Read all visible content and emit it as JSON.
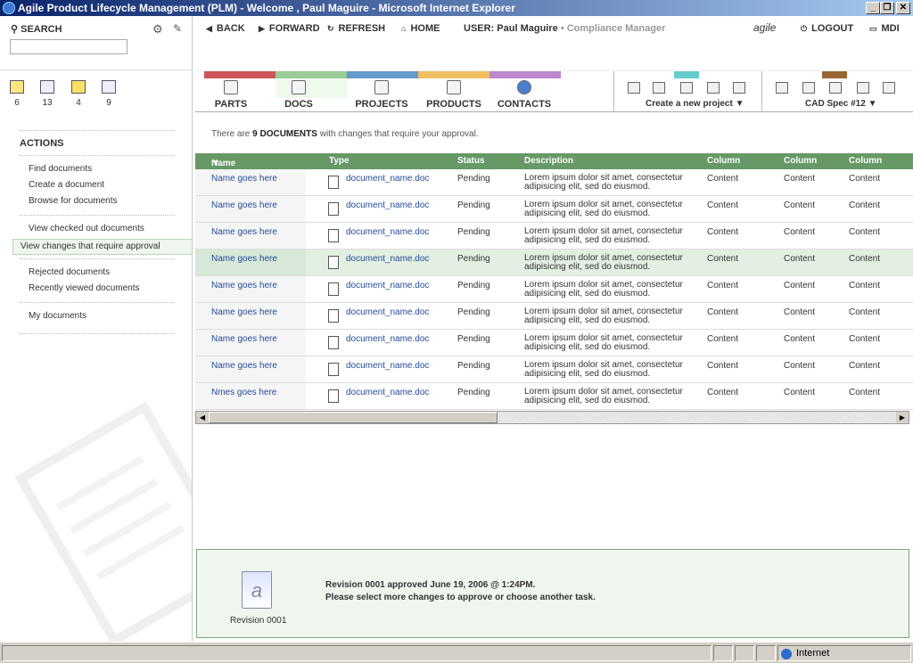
{
  "window": {
    "title": "Agile Product Lifecycle Management (PLM) - Welcome , Paul Maguire - Microsoft Internet Explorer"
  },
  "left": {
    "search_label": "SEARCH",
    "quick_counts": [
      "6",
      "13",
      "4",
      "9"
    ],
    "actions_title": "ACTIONS",
    "group1": [
      "Find documents",
      "Create a document",
      "Browse for documents"
    ],
    "group2": [
      "View checked out documents",
      "View changes that require approval"
    ],
    "group3": [
      "Rejected documents",
      "Recently viewed documents"
    ],
    "group4": [
      "My documents"
    ]
  },
  "toolbar": {
    "back": "BACK",
    "forward": "FORWARD",
    "refresh": "REFRESH",
    "home": "HOME",
    "user_label": "USER:",
    "user_name": "Paul Maguire",
    "user_role": "• Compliance Manager",
    "brand": "agile",
    "logout": "LOGOUT",
    "mdi": "MDI"
  },
  "nav": {
    "tabs": [
      "PARTS",
      "DOCS",
      "PROJECTS",
      "PRODUCTS",
      "CONTACTS"
    ],
    "tab_colors": [
      "#cc5555",
      "#99cc99",
      "#6699cc",
      "#f0c060",
      "#bb88cc"
    ],
    "project_dropdown": "Create a new project",
    "cad_dropdown": "CAD Spec #12"
  },
  "info": {
    "prefix": "There are ",
    "count": "9 DOCUMENTS",
    "suffix": " with changes that require your approval."
  },
  "table": {
    "headers": [
      "Name",
      "Type",
      "Status",
      "Description",
      "Column",
      "Column",
      "Column"
    ],
    "sort_indicator": "▼",
    "rows": [
      {
        "name": "Name goes here",
        "type": "document_name.doc",
        "status": "Pending",
        "desc": "Lorem ipsum dolor sit amet, consectetur adipisicing elit, sed do eiusmod.",
        "c1": "Content",
        "c2": "Content",
        "c3": "Content"
      },
      {
        "name": "Name goes here",
        "type": "document_name.doc",
        "status": "Pending",
        "desc": "Lorem ipsum dolor sit amet, consectetur adipisicing elit, sed do eiusmod.",
        "c1": "Content",
        "c2": "Content",
        "c3": "Content"
      },
      {
        "name": "Name goes here",
        "type": "document_name.doc",
        "status": "Pending",
        "desc": "Lorem ipsum dolor sit amet, consectetur adipisicing elit, sed do eiusmod.",
        "c1": "Content",
        "c2": "Content",
        "c3": "Content"
      },
      {
        "name": "Name goes here",
        "type": "document_name.doc",
        "status": "Pending",
        "desc": "Lorem ipsum dolor sit amet, consectetur adipisicing elit, sed do eiusmod.",
        "c1": "Content",
        "c2": "Content",
        "c3": "Content"
      },
      {
        "name": "Name goes here",
        "type": "document_name.doc",
        "status": "Pending",
        "desc": "Lorem ipsum dolor sit amet, consectetur adipisicing elit, sed do eiusmod.",
        "c1": "Content",
        "c2": "Content",
        "c3": "Content"
      },
      {
        "name": "Name goes here",
        "type": "document_name.doc",
        "status": "Pending",
        "desc": "Lorem ipsum dolor sit amet, consectetur adipisicing elit, sed do eiusmod.",
        "c1": "Content",
        "c2": "Content",
        "c3": "Content"
      },
      {
        "name": "Name goes here",
        "type": "document_name.doc",
        "status": "Pending",
        "desc": "Lorem ipsum dolor sit amet, consectetur adipisicing elit, sed do eiusmod.",
        "c1": "Content",
        "c2": "Content",
        "c3": "Content"
      },
      {
        "name": "Name goes here",
        "type": "document_name.doc",
        "status": "Pending",
        "desc": "Lorem ipsum dolor sit amet, consectetur adipisicing elit, sed do eiusmod.",
        "c1": "Content",
        "c2": "Content",
        "c3": "Content"
      },
      {
        "name": "Nmes goes here",
        "type": "document_name.doc",
        "status": "Pending",
        "desc": "Lorem ipsum dolor sit amet, consectetur adipisicing elit, sed do eiusmod.",
        "c1": "Content",
        "c2": "Content",
        "c3": "Content"
      }
    ]
  },
  "notice": {
    "revision_label": "Revision 0001",
    "line1": "Revision 0001 approved June 19, 2006 @ 1:24PM.",
    "line2": "Please select more changes to approve or choose another task."
  },
  "status": {
    "zone": "Internet"
  }
}
